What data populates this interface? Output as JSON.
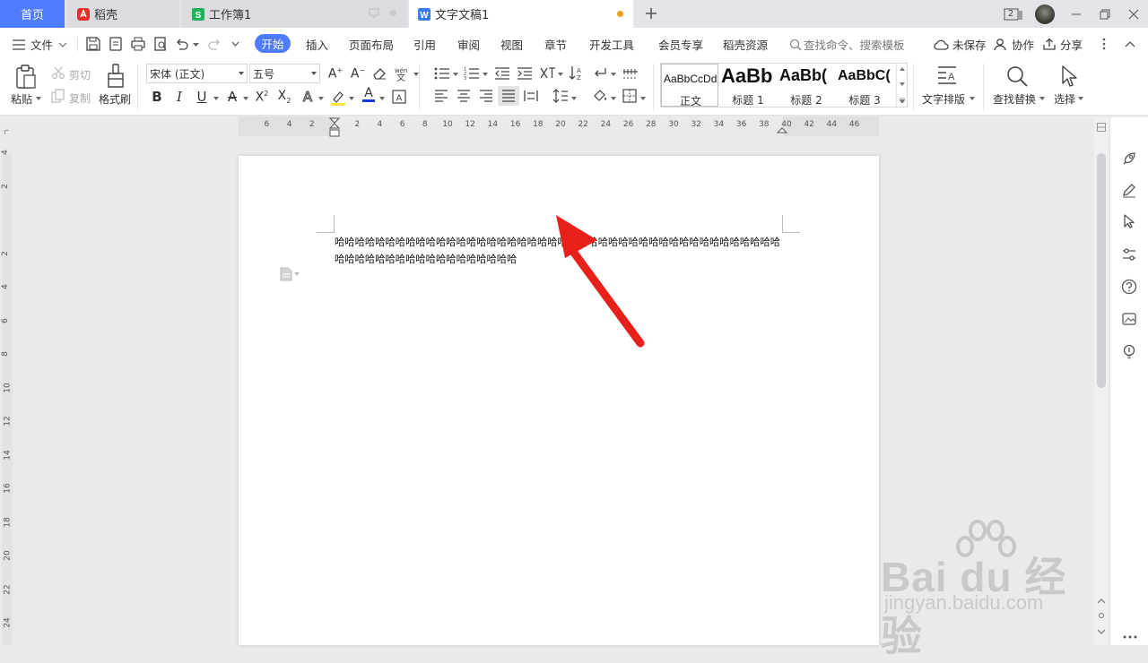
{
  "tabs": {
    "home": "首页",
    "daoke": "稻壳",
    "sheet": "工作簿1",
    "doc": "文字文稿1",
    "page_counter": "2"
  },
  "menu": {
    "file": "文件",
    "items": [
      "开始",
      "插入",
      "页面布局",
      "引用",
      "审阅",
      "视图",
      "章节",
      "开发工具",
      "会员专享",
      "稻壳资源"
    ],
    "search": "查找命令、搜索模板",
    "unsaved": "未保存",
    "collab": "协作",
    "share": "分享"
  },
  "ribbon": {
    "paste": "粘贴",
    "cut": "剪切",
    "copy": "复制",
    "format_painter": "格式刷",
    "font_name": "宋体 (正文)",
    "font_size": "五号",
    "text_layout": "文字排版",
    "find_replace": "查找替换",
    "select": "选择"
  },
  "styles": [
    {
      "sample": "AaBbCcDd",
      "name": "正文"
    },
    {
      "sample": "AaBb",
      "name": "标题 1"
    },
    {
      "sample": "AaBb(",
      "name": "标题 2"
    },
    {
      "sample": "AaBbC(",
      "name": "标题 3"
    }
  ],
  "ruler": {
    "horizontal": [
      "6",
      "4",
      "2",
      "2",
      "4",
      "6",
      "8",
      "10",
      "12",
      "14",
      "16",
      "18",
      "20",
      "22",
      "24",
      "26",
      "28",
      "30",
      "32",
      "34",
      "36",
      "38",
      "40",
      "42",
      "44",
      "46"
    ],
    "vertical": [
      "4",
      "2",
      "2",
      "4",
      "6",
      "8",
      "10",
      "12",
      "14",
      "16",
      "18",
      "20",
      "22",
      "24"
    ]
  },
  "document": {
    "text": "哈哈哈哈哈哈哈哈哈哈哈哈哈哈哈哈哈哈哈哈哈哈哈哈哈哈哈哈哈哈哈哈哈哈哈哈哈哈哈哈哈哈哈哈哈哈哈哈哈哈哈哈哈哈哈哈哈哈哈哈哈哈"
  },
  "watermark": {
    "main": "Bai du 经验",
    "sub": "jingyan.baidu.com"
  },
  "colors": {
    "accent": "#4d7cff",
    "annotation": "#e8201a",
    "tab_dot": "#f0a020"
  }
}
